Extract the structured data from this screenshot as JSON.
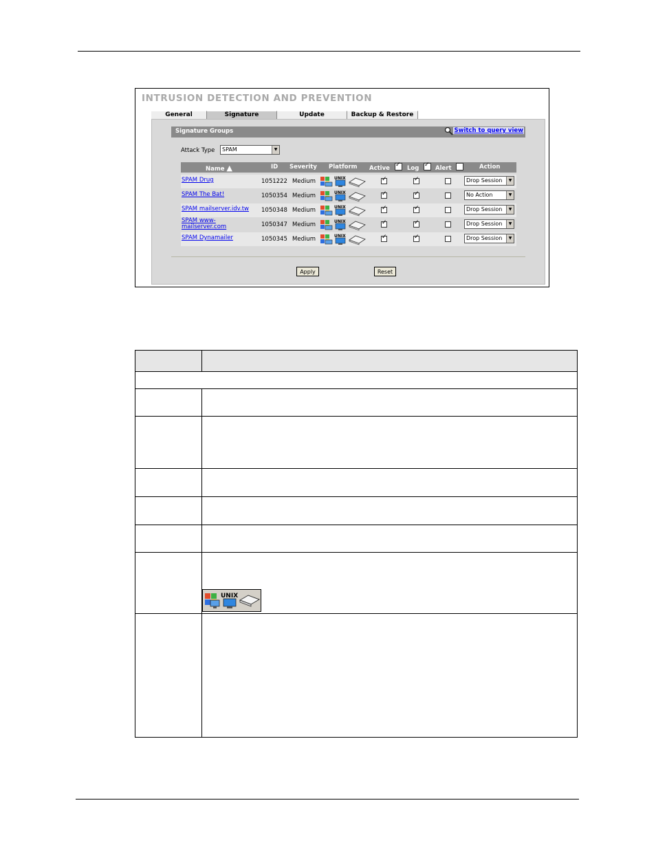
{
  "screenshot": {
    "title": "INTRUSION DETECTION AND PREVENTION",
    "tabs": [
      {
        "label": "General",
        "active": false
      },
      {
        "label": "Signature",
        "active": true
      },
      {
        "label": "Update",
        "active": false
      },
      {
        "label": "Backup & Restore",
        "active": false
      }
    ],
    "section_title": "Signature Groups",
    "query_link": "Switch to query view",
    "attack_type": {
      "label": "Attack Type",
      "value": "SPAM"
    },
    "columns": {
      "name": "Name",
      "id": "ID",
      "severity": "Severity",
      "platform": "Platform",
      "active": "Active",
      "log": "Log",
      "alert": "Alert",
      "action": "Action"
    },
    "header_checks": {
      "active": true,
      "log": true,
      "alert": false
    },
    "rows": [
      {
        "name": "SPAM Drug",
        "id": "1051222",
        "severity": "Medium",
        "active": true,
        "log": true,
        "alert": false,
        "action": "Drop Session"
      },
      {
        "name": "SPAM The Bat!",
        "id": "1050354",
        "severity": "Medium",
        "active": true,
        "log": true,
        "alert": false,
        "action": "No Action"
      },
      {
        "name": "SPAM mailserver.idv.tw",
        "id": "1050348",
        "severity": "Medium",
        "active": true,
        "log": true,
        "alert": false,
        "action": "Drop Session"
      },
      {
        "name": "SPAM www-mailserver.com",
        "id": "1050347",
        "severity": "Medium",
        "active": true,
        "log": true,
        "alert": false,
        "action": "Drop Session"
      },
      {
        "name": "SPAM Dynamailer",
        "id": "1050345",
        "severity": "Medium",
        "active": true,
        "log": true,
        "alert": false,
        "action": "Drop Session"
      }
    ],
    "buttons": {
      "apply": "Apply",
      "reset": "Reset"
    },
    "platform_icons": [
      "windows-icon",
      "unix-icon",
      "other-os-icon"
    ],
    "unix_text": "UNIX"
  }
}
